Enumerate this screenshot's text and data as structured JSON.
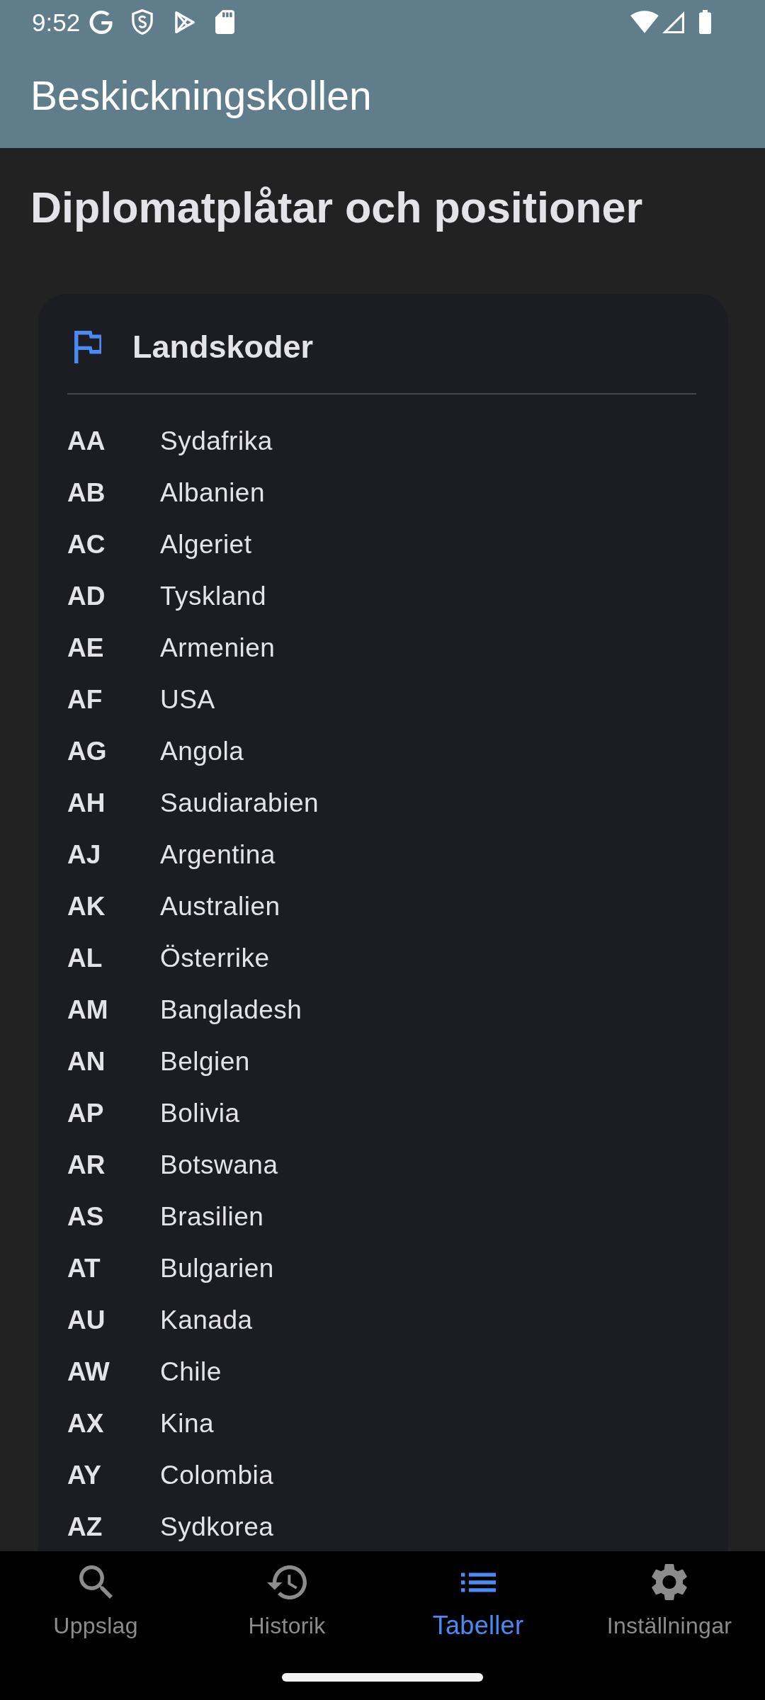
{
  "status_bar": {
    "time": "9:52"
  },
  "app_bar": {
    "title": "Beskickningskollen"
  },
  "page": {
    "heading": "Diplomatplåtar och positioner"
  },
  "card": {
    "title": "Landskoder",
    "rows": [
      {
        "code": "AA",
        "country": "Sydafrika"
      },
      {
        "code": "AB",
        "country": "Albanien"
      },
      {
        "code": "AC",
        "country": "Algeriet"
      },
      {
        "code": "AD",
        "country": "Tyskland"
      },
      {
        "code": "AE",
        "country": "Armenien"
      },
      {
        "code": "AF",
        "country": "USA"
      },
      {
        "code": "AG",
        "country": "Angola"
      },
      {
        "code": "AH",
        "country": "Saudiarabien"
      },
      {
        "code": "AJ",
        "country": "Argentina"
      },
      {
        "code": "AK",
        "country": "Australien"
      },
      {
        "code": "AL",
        "country": "Österrike"
      },
      {
        "code": "AM",
        "country": "Bangladesh"
      },
      {
        "code": "AN",
        "country": "Belgien"
      },
      {
        "code": "AP",
        "country": "Bolivia"
      },
      {
        "code": "AR",
        "country": "Botswana"
      },
      {
        "code": "AS",
        "country": "Brasilien"
      },
      {
        "code": "AT",
        "country": "Bulgarien"
      },
      {
        "code": "AU",
        "country": "Kanada"
      },
      {
        "code": "AW",
        "country": "Chile"
      },
      {
        "code": "AX",
        "country": "Kina"
      },
      {
        "code": "AY",
        "country": "Colombia"
      },
      {
        "code": "AZ",
        "country": "Sydkorea"
      }
    ]
  },
  "bottom_nav": {
    "items": [
      {
        "label": "Uppslag",
        "selected": false
      },
      {
        "label": "Historik",
        "selected": false
      },
      {
        "label": "Tabeller",
        "selected": true
      },
      {
        "label": "Inställningar",
        "selected": false
      }
    ]
  }
}
